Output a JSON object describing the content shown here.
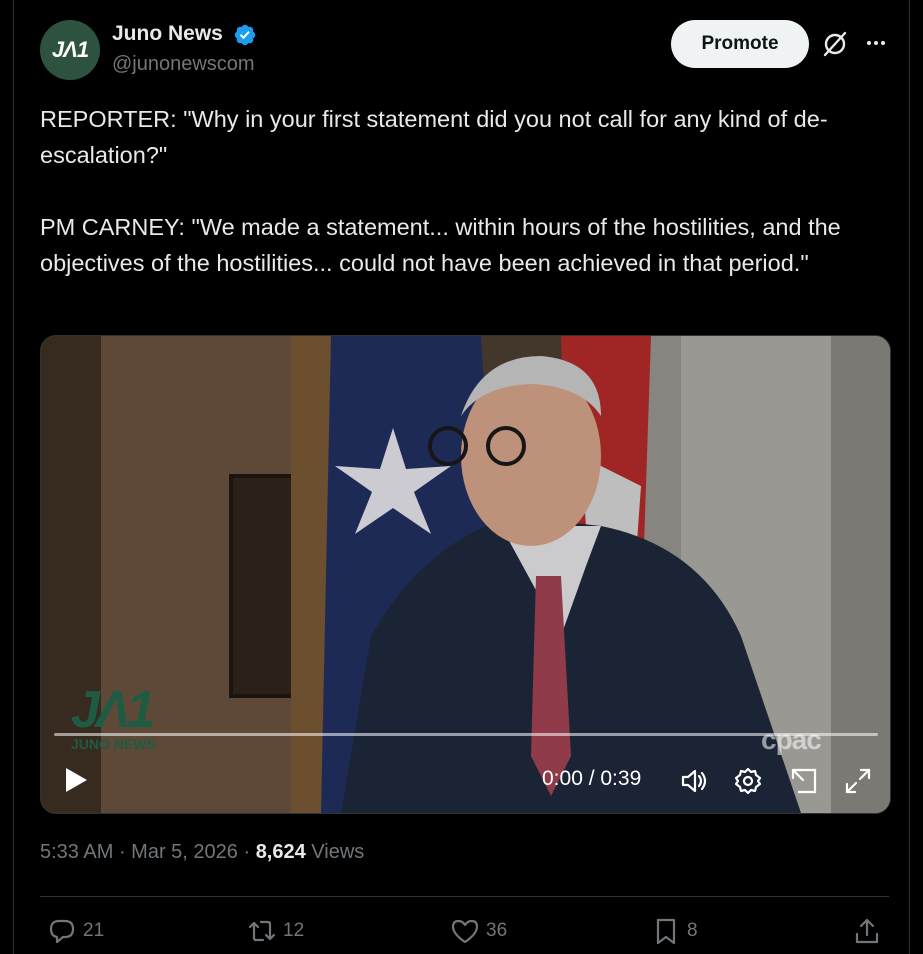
{
  "author": {
    "avatar_text": "JΛ1",
    "name": "Juno News",
    "handle": "@junonewscom",
    "verified": true
  },
  "header": {
    "promote_label": "Promote",
    "grok_icon": "grok-icon",
    "more_icon": "more-icon"
  },
  "tweet": {
    "text": "REPORTER: \"Why in your first statement did you not call for any kind of de-escalation?\"\n\nPM CARNEY: \"We made a statement... within hours of the hostilities, and the objectives of the hostilities... could not have been achieved in that period.\""
  },
  "video": {
    "time": "0:00 / 0:39",
    "progress": 0,
    "watermark_left": "JUNO NEWS",
    "watermark_right": "cpac"
  },
  "meta": {
    "time": "5:33 AM",
    "separator": " · ",
    "date": "Mar 5, 2026",
    "views_count": "8,624",
    "views_label": " Views"
  },
  "actions": {
    "replies": "21",
    "reposts": "12",
    "likes": "36",
    "bookmarks": "8"
  },
  "colors": {
    "background": "#000000",
    "text": "#e7e9ea",
    "muted": "#71767b",
    "verified": "#1d9bf0",
    "avatar_bg": "#2d5240"
  }
}
